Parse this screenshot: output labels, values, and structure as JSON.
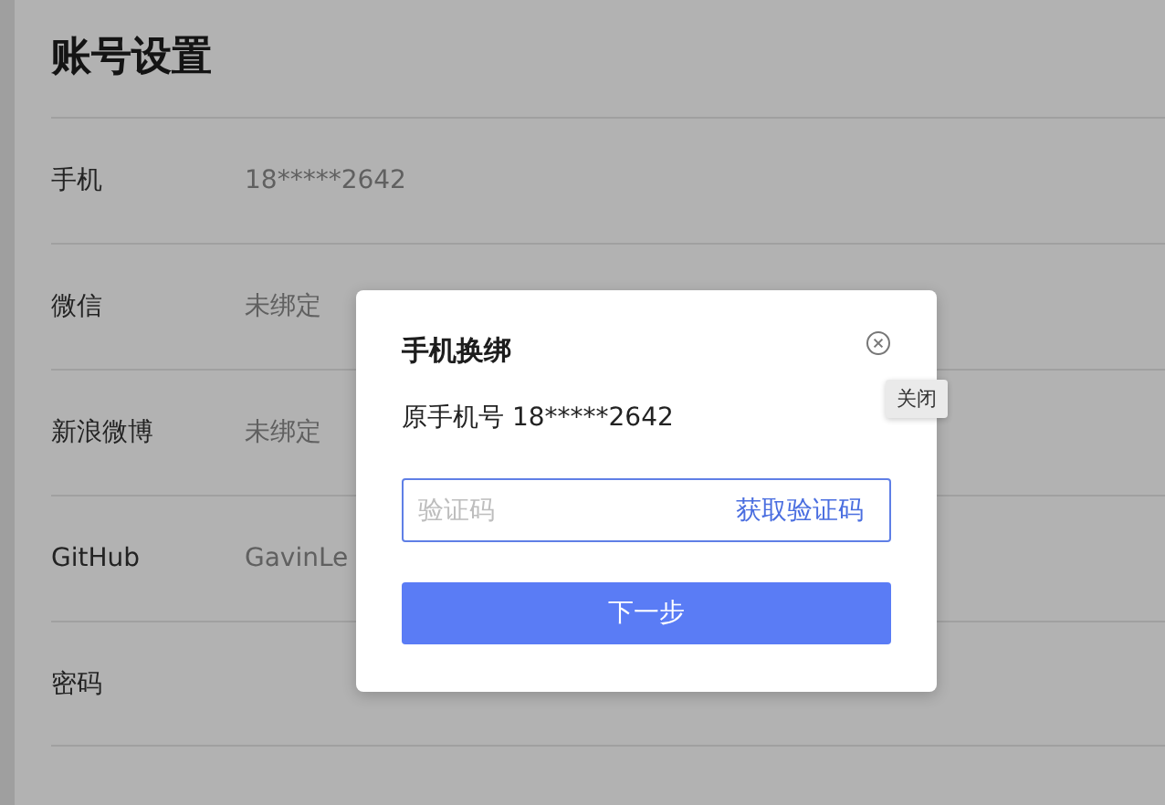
{
  "page": {
    "title": "账号设置",
    "rows": [
      {
        "label": "手机",
        "value": "18*****2642"
      },
      {
        "label": "微信",
        "value": "未绑定"
      },
      {
        "label": "新浪微博",
        "value": "未绑定"
      },
      {
        "label": "GitHub",
        "value": "GavinLe"
      },
      {
        "label": "密码"
      }
    ]
  },
  "dialog": {
    "title": "手机换绑",
    "close_tooltip": "关闭",
    "current_phone": "原手机号 18*****2642",
    "code_field": {
      "placeholder": "验证码",
      "action": "获取验证码"
    },
    "next_button": "下一步"
  }
}
